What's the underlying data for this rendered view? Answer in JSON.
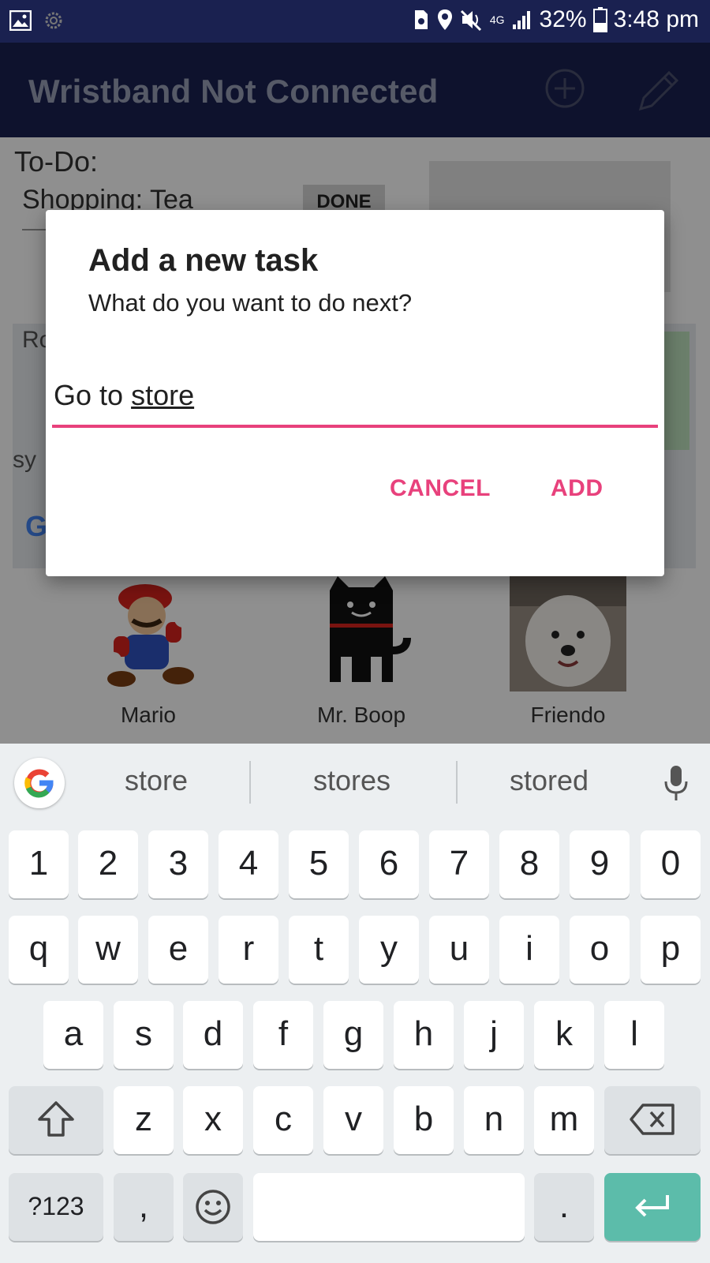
{
  "status_bar": {
    "battery_percent": "32%",
    "time": "3:48 pm",
    "network": "4G",
    "icons": [
      "image-icon",
      "settings-icon",
      "sim-icon",
      "location-icon",
      "mute-icon",
      "signal-icon",
      "battery-icon"
    ]
  },
  "app_bar": {
    "title": "Wristband Not Connected",
    "actions": [
      "add-circle-icon",
      "pencil-icon"
    ]
  },
  "background": {
    "todo_label": "To-Do:",
    "todo_item": "Shopping: Tea",
    "done_label": "DONE",
    "map_ro": "Ro",
    "map_sy": "sy",
    "map_g": "G",
    "contacts": [
      {
        "name": "Mario"
      },
      {
        "name": "Mr. Boop"
      },
      {
        "name": "Friendo"
      }
    ]
  },
  "dialog": {
    "title": "Add a new task",
    "message": "What do you want to do next?",
    "input_prefix": "Go to ",
    "input_word": "store",
    "cancel_label": "CANCEL",
    "add_label": "ADD",
    "accent_color": "#e8417c"
  },
  "keyboard": {
    "suggestions": [
      "store",
      "stores",
      "stored"
    ],
    "row_numbers": [
      "1",
      "2",
      "3",
      "4",
      "5",
      "6",
      "7",
      "8",
      "9",
      "0"
    ],
    "row_q": [
      "q",
      "w",
      "e",
      "r",
      "t",
      "y",
      "u",
      "i",
      "o",
      "p"
    ],
    "row_a": [
      "a",
      "s",
      "d",
      "f",
      "g",
      "h",
      "j",
      "k",
      "l"
    ],
    "row_z": [
      "z",
      "x",
      "c",
      "v",
      "b",
      "n",
      "m"
    ],
    "symbols_label": "?123",
    "comma_label": ",",
    "period_label": ".",
    "enter_color": "#5cbcaa"
  }
}
